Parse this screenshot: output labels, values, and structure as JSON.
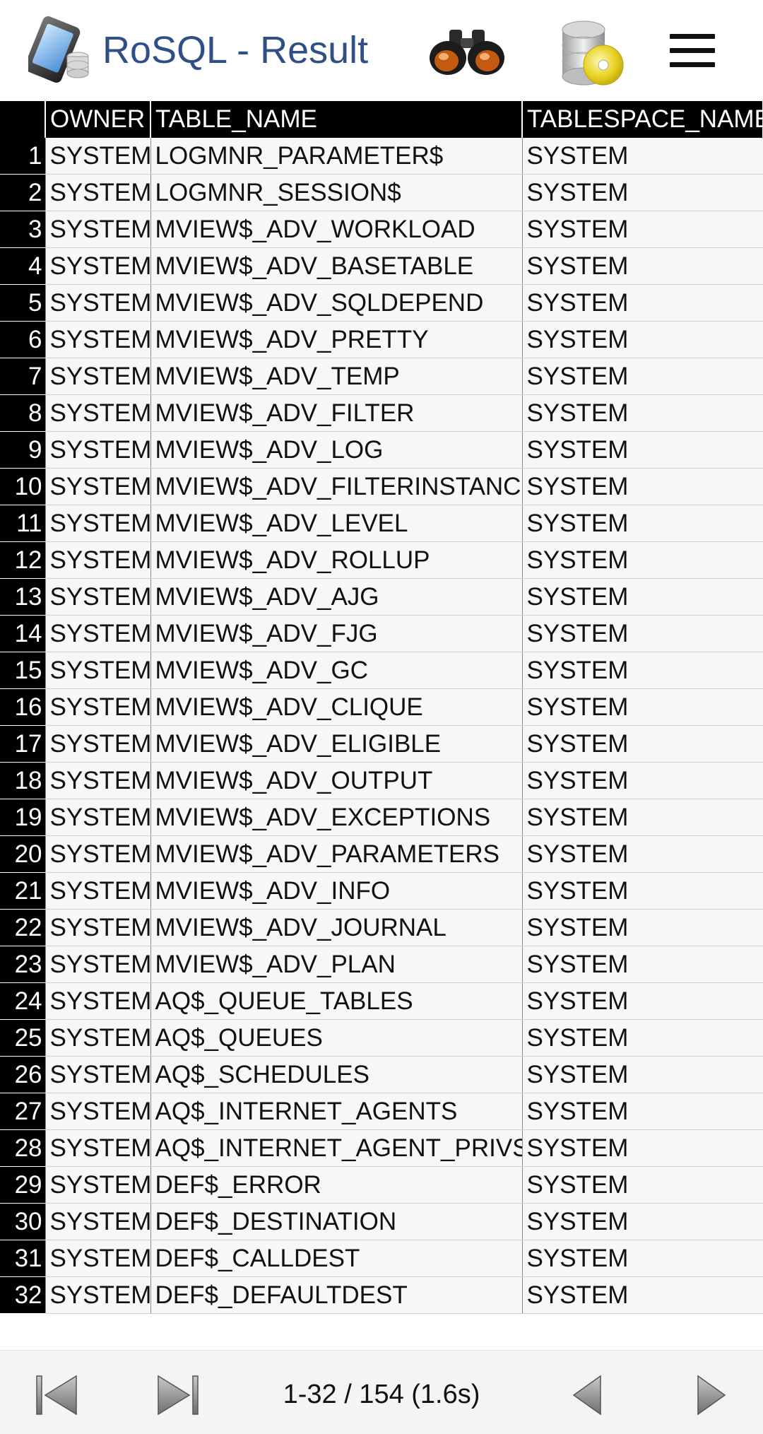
{
  "header": {
    "title": "RoSQL - Result",
    "icons": [
      "app-logo-icon",
      "binoculars-icon",
      "database-disk-icon",
      "menu-icon"
    ]
  },
  "table": {
    "columns": [
      "",
      "OWNER",
      "TABLE_NAME",
      "TABLESPACE_NAME"
    ],
    "rows": [
      [
        "1",
        "SYSTEM",
        "LOGMNR_PARAMETER$",
        "SYSTEM"
      ],
      [
        "2",
        "SYSTEM",
        "LOGMNR_SESSION$",
        "SYSTEM"
      ],
      [
        "3",
        "SYSTEM",
        "MVIEW$_ADV_WORKLOAD",
        "SYSTEM"
      ],
      [
        "4",
        "SYSTEM",
        "MVIEW$_ADV_BASETABLE",
        "SYSTEM"
      ],
      [
        "5",
        "SYSTEM",
        "MVIEW$_ADV_SQLDEPEND",
        "SYSTEM"
      ],
      [
        "6",
        "SYSTEM",
        "MVIEW$_ADV_PRETTY",
        "SYSTEM"
      ],
      [
        "7",
        "SYSTEM",
        "MVIEW$_ADV_TEMP",
        "SYSTEM"
      ],
      [
        "8",
        "SYSTEM",
        "MVIEW$_ADV_FILTER",
        "SYSTEM"
      ],
      [
        "9",
        "SYSTEM",
        "MVIEW$_ADV_LOG",
        "SYSTEM"
      ],
      [
        "10",
        "SYSTEM",
        "MVIEW$_ADV_FILTERINSTANCE",
        "SYSTEM"
      ],
      [
        "11",
        "SYSTEM",
        "MVIEW$_ADV_LEVEL",
        "SYSTEM"
      ],
      [
        "12",
        "SYSTEM",
        "MVIEW$_ADV_ROLLUP",
        "SYSTEM"
      ],
      [
        "13",
        "SYSTEM",
        "MVIEW$_ADV_AJG",
        "SYSTEM"
      ],
      [
        "14",
        "SYSTEM",
        "MVIEW$_ADV_FJG",
        "SYSTEM"
      ],
      [
        "15",
        "SYSTEM",
        "MVIEW$_ADV_GC",
        "SYSTEM"
      ],
      [
        "16",
        "SYSTEM",
        "MVIEW$_ADV_CLIQUE",
        "SYSTEM"
      ],
      [
        "17",
        "SYSTEM",
        "MVIEW$_ADV_ELIGIBLE",
        "SYSTEM"
      ],
      [
        "18",
        "SYSTEM",
        "MVIEW$_ADV_OUTPUT",
        "SYSTEM"
      ],
      [
        "19",
        "SYSTEM",
        "MVIEW$_ADV_EXCEPTIONS",
        "SYSTEM"
      ],
      [
        "20",
        "SYSTEM",
        "MVIEW$_ADV_PARAMETERS",
        "SYSTEM"
      ],
      [
        "21",
        "SYSTEM",
        "MVIEW$_ADV_INFO",
        "SYSTEM"
      ],
      [
        "22",
        "SYSTEM",
        "MVIEW$_ADV_JOURNAL",
        "SYSTEM"
      ],
      [
        "23",
        "SYSTEM",
        "MVIEW$_ADV_PLAN",
        "SYSTEM"
      ],
      [
        "24",
        "SYSTEM",
        "AQ$_QUEUE_TABLES",
        "SYSTEM"
      ],
      [
        "25",
        "SYSTEM",
        "AQ$_QUEUES",
        "SYSTEM"
      ],
      [
        "26",
        "SYSTEM",
        "AQ$_SCHEDULES",
        "SYSTEM"
      ],
      [
        "27",
        "SYSTEM",
        "AQ$_INTERNET_AGENTS",
        "SYSTEM"
      ],
      [
        "28",
        "SYSTEM",
        "AQ$_INTERNET_AGENT_PRIVS",
        "SYSTEM"
      ],
      [
        "29",
        "SYSTEM",
        "DEF$_ERROR",
        "SYSTEM"
      ],
      [
        "30",
        "SYSTEM",
        "DEF$_DESTINATION",
        "SYSTEM"
      ],
      [
        "31",
        "SYSTEM",
        "DEF$_CALLDEST",
        "SYSTEM"
      ],
      [
        "32",
        "SYSTEM",
        "DEF$_DEFAULTDEST",
        "SYSTEM"
      ]
    ]
  },
  "footer": {
    "status": "1-32 / 154 (1.6s)",
    "icons": [
      "first-page-icon",
      "last-page-icon",
      "previous-page-icon",
      "next-page-icon"
    ]
  },
  "colors": {
    "title": "#2f4f86",
    "header_cell_bg": "#000000",
    "row_bg": "#f7f7f7",
    "footer_bg": "#f4f4f4"
  }
}
